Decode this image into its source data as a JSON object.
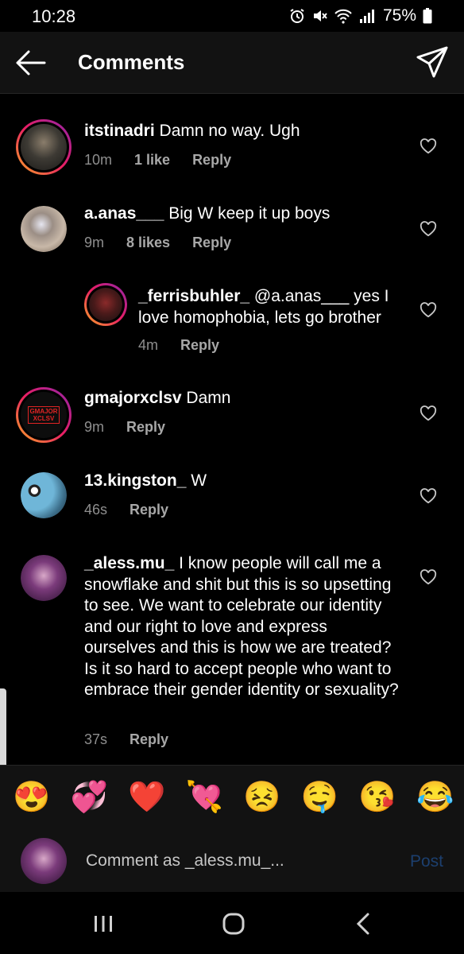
{
  "status_bar": {
    "time": "10:28",
    "battery": "75%",
    "icons": [
      "alarm-icon",
      "mute-icon",
      "wifi-icon",
      "signal-icon",
      "battery-icon"
    ]
  },
  "header": {
    "title": "Comments",
    "back_icon": "arrow-left-icon",
    "share_icon": "send-icon"
  },
  "comments": [
    {
      "username": "itstinadri",
      "text": " Damn no way. Ugh",
      "time": "10m",
      "likes": "1 like",
      "reply": "Reply"
    },
    {
      "username": "a.anas___",
      "text": " Big W keep it up boys",
      "time": "9m",
      "likes": "8 likes",
      "reply": "Reply"
    },
    {
      "username": "_ferrisbuhler_",
      "text": " @a.anas___ yes I love homophobia, lets go brother",
      "time": "4m",
      "reply": "Reply"
    },
    {
      "username": "gmajorxclsv",
      "text": " Damn",
      "time": "9m",
      "reply": "Reply",
      "avatar_text": "GMAJOR XCLSV"
    },
    {
      "username": "13.kingston_",
      "text": " W",
      "time": "46s",
      "reply": "Reply"
    },
    {
      "username": "_aless.mu_",
      "text": " I know people will call me a snowflake and shit but this is so upsetting to see. We want to celebrate our identity and our right to love and express ourselves and this is how we are treated? Is it so hard to accept people who want to embrace their gender identity or sexuality?",
      "time": "37s",
      "reply": "Reply"
    }
  ],
  "emojis": [
    "😍",
    "💞",
    "❤️",
    "💘",
    "😣",
    "🤤",
    "😘",
    "😂"
  ],
  "composer": {
    "placeholder": "Comment as _aless.mu_...",
    "post_label": "Post"
  },
  "colors": {
    "background": "#000000",
    "header_bg": "#121212",
    "muted_text": "#8e8e8e",
    "post_disabled": "#1c3f6e"
  }
}
